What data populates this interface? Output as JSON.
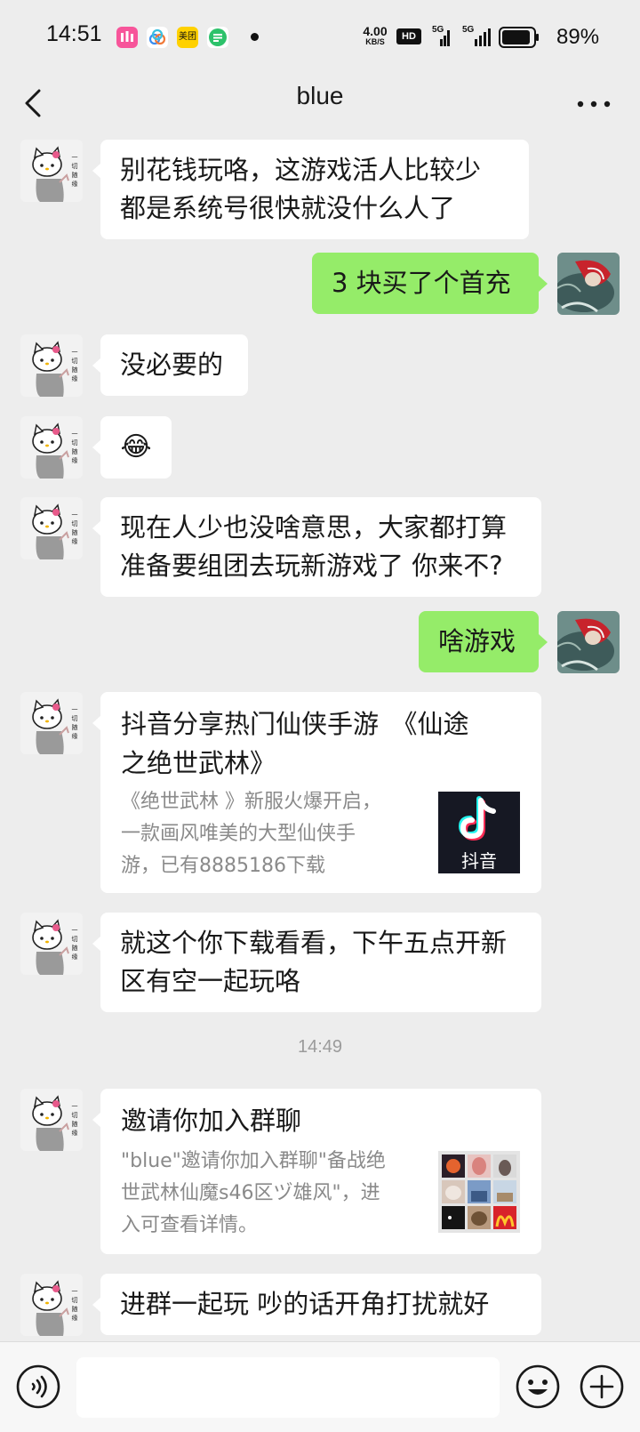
{
  "status_bar": {
    "time": "14:51",
    "app_icons": [
      {
        "name": "video-app-icon",
        "color": "#F7559A",
        "glyph": "▶"
      },
      {
        "name": "cloud-app-icon",
        "color": "#FFFFFF",
        "glyph": "◎"
      },
      {
        "name": "meituan-icon",
        "color": "#FFD100",
        "label": "美团"
      },
      {
        "name": "message-app-icon",
        "color": "#2DC26B",
        "glyph": "≡"
      }
    ],
    "network_speed_value": "4.00",
    "network_speed_unit": "KB/S",
    "hd_label": "HD",
    "signal_label_1": "5G",
    "signal_label_2": "5G",
    "battery_percent": "89%",
    "battery_level": 0.89
  },
  "title_bar": {
    "title": "blue"
  },
  "messages": {
    "m1_line1": "别花钱玩咯，这游戏活人比较少",
    "m1_line2": "都是系统号很快就没什么人了",
    "m2": "3 块买了个首充",
    "m3": "没必要的",
    "m4_emoji": "😂",
    "m5_line1": "现在人少也没啥意思，大家都打算",
    "m5_line2": "准备要组团去玩新游戏了 你来不?",
    "m6": "啥游戏",
    "card1": {
      "title_line1": "抖音分享热门仙侠手游　《仙途",
      "title_line2": "之绝世武林》",
      "desc_line1": "《绝世武林 》新服火爆开启，",
      "desc_line2": "一款画风唯美的大型仙侠手",
      "desc_line3": "游，已有8885186下载",
      "thumb_label": "抖音"
    },
    "m8_line1": "就这个你下载看看，下午五点开新",
    "m8_line2": "区有空一起玩咯",
    "timestamp": "14:49",
    "card2": {
      "title": "邀请你加入群聊",
      "desc_line1": "\"blue\"邀请你加入群聊\"备战绝",
      "desc_line2": "世武林仙魔s46区ヅ雄风\"，进",
      "desc_line3": "入可查看详情。"
    },
    "m10_partial": "进群一起玩 吵的话开角打扰就好"
  },
  "input_bar": {
    "placeholder": ""
  },
  "colors": {
    "background": "#EDEDED",
    "my_bubble": "#95EC69",
    "their_bubble": "#FFFFFF"
  }
}
